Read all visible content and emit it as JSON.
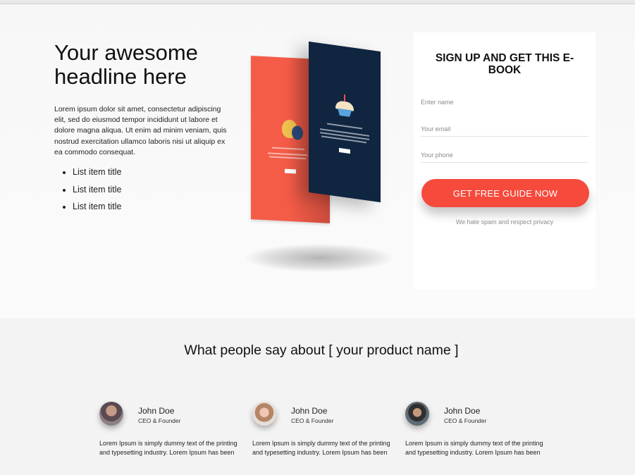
{
  "hero": {
    "headline": "Your awesome headline here",
    "intro": "Lorem ipsum dolor sit amet, consectetur adipiscing elit, sed do eiusmod tempor incididunt ut labore et dolore magna aliqua. Ut enim ad minim veniam, quis nostrud exercitation ullamco laboris nisi ut aliquip ex ea commodo consequat.",
    "list_items": [
      "List item title",
      "List item title",
      "List item title"
    ]
  },
  "mockup": {
    "screen_colors": {
      "front": "#0f2540",
      "back": "#f55c48"
    },
    "icons": [
      "cupcake-icon",
      "balloons-icon"
    ]
  },
  "signup": {
    "title": "SIGN UP AND GET THIS E-BOOK",
    "fields": {
      "name_placeholder": "Enter name",
      "email_placeholder": "Your email",
      "phone_placeholder": "Your phone"
    },
    "cta_label": "GET FREE GUIDE NOW",
    "privacy_note": "We hate spam and respect privacy",
    "accent_color": "#f54a3c"
  },
  "testimonials": {
    "title": "What people say about [ your product name ]",
    "items": [
      {
        "name": "John Doe",
        "role": "CEO & Founder",
        "text": "Lorem Ipsum is simply dummy text of the printing and typesetting industry. Lorem Ipsum has been"
      },
      {
        "name": "John Doe",
        "role": "CEO & Founder",
        "text": "Lorem Ipsum is simply dummy text of the printing and typesetting industry. Lorem Ipsum has been"
      },
      {
        "name": "John Doe",
        "role": "CEO & Founder",
        "text": "Lorem Ipsum is simply dummy text of the printing and typesetting industry. Lorem Ipsum has been"
      }
    ]
  }
}
